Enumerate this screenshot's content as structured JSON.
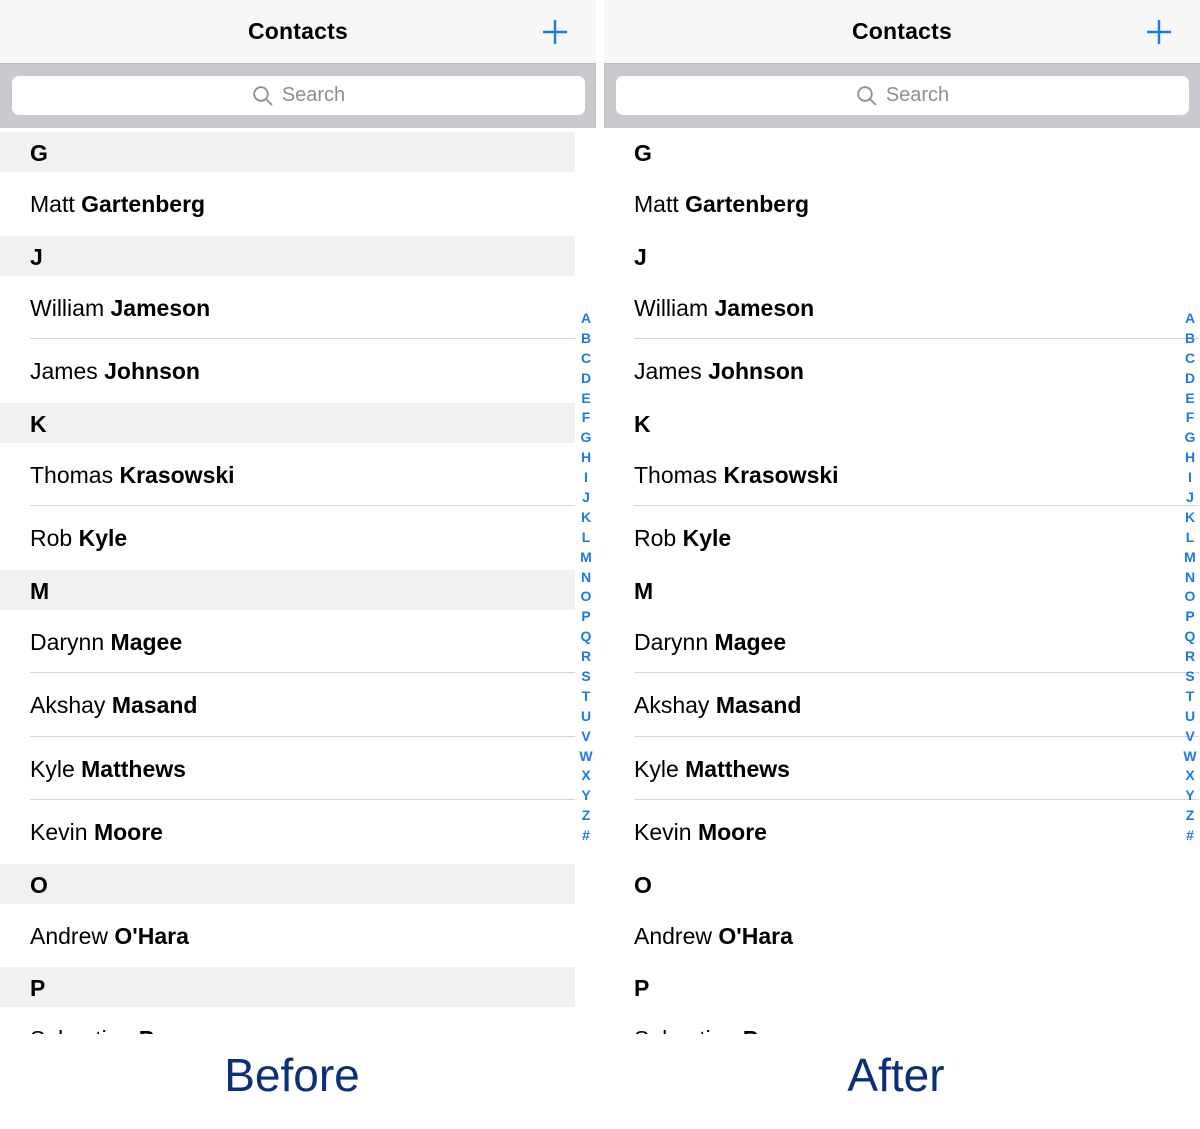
{
  "colors": {
    "accent": "#1a7ae8",
    "caption": "#0c2f79",
    "section_bg_before": "#f1f1f1",
    "section_bg_after": "#ffffff",
    "searchbar_bg": "#c9c9ce"
  },
  "panels": [
    {
      "id": "before",
      "nav_title": "Contacts",
      "add_icon": "plus-icon",
      "search": {
        "placeholder": "Search",
        "icon": "search-icon"
      },
      "caption": "Before"
    },
    {
      "id": "after",
      "nav_title": "Contacts",
      "add_icon": "plus-icon",
      "search": {
        "placeholder": "Search",
        "icon": "search-icon"
      },
      "caption": "After"
    }
  ],
  "sections": [
    {
      "letter": "G",
      "contacts": [
        {
          "first": "Matt",
          "last": "Gartenberg"
        }
      ]
    },
    {
      "letter": "J",
      "contacts": [
        {
          "first": "William",
          "last": "Jameson"
        },
        {
          "first": "James",
          "last": "Johnson"
        }
      ]
    },
    {
      "letter": "K",
      "contacts": [
        {
          "first": "Thomas",
          "last": "Krasowski"
        },
        {
          "first": "Rob",
          "last": "Kyle"
        }
      ]
    },
    {
      "letter": "M",
      "contacts": [
        {
          "first": "Darynn",
          "last": "Magee"
        },
        {
          "first": "Akshay",
          "last": "Masand"
        },
        {
          "first": "Kyle",
          "last": "Matthews"
        },
        {
          "first": "Kevin",
          "last": "Moore"
        }
      ]
    },
    {
      "letter": "O",
      "contacts": [
        {
          "first": "Andrew",
          "last": "O'Hara"
        }
      ]
    },
    {
      "letter": "P",
      "contacts": [
        {
          "first": "Sebastian",
          "last": "P"
        }
      ]
    }
  ],
  "index_letters": [
    "A",
    "B",
    "C",
    "D",
    "E",
    "F",
    "G",
    "H",
    "I",
    "J",
    "K",
    "L",
    "M",
    "N",
    "O",
    "P",
    "Q",
    "R",
    "S",
    "T",
    "U",
    "V",
    "W",
    "X",
    "Y",
    "Z",
    "#"
  ]
}
